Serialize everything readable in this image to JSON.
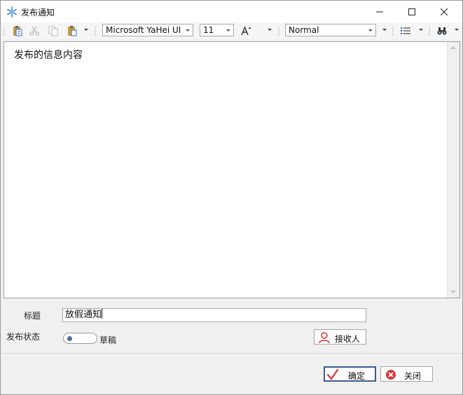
{
  "window": {
    "title": "发布通知",
    "icon": "snowflake-icon"
  },
  "toolbar": {
    "font_name": "Microsoft YaHei UI",
    "font_size": "11",
    "font_size_icon": "grow-font-icon",
    "style": "Normal",
    "icons": [
      "paste-special-icon",
      "cut-icon",
      "copy-icon",
      "paste-icon",
      "bullet-list-icon",
      "find-icon"
    ]
  },
  "editor": {
    "content": "发布的信息内容"
  },
  "form": {
    "title_label": "标题",
    "title_value": "放假通知",
    "status_label": "发布状态",
    "status_toggle_label": "草稿",
    "recipients_button": "接收人"
  },
  "footer": {
    "ok_label": "确定",
    "close_label": "关闭"
  },
  "colors": {
    "accent": "#3b5b94",
    "ok_check": "#d9383c",
    "close_icon": "#d9383c"
  }
}
